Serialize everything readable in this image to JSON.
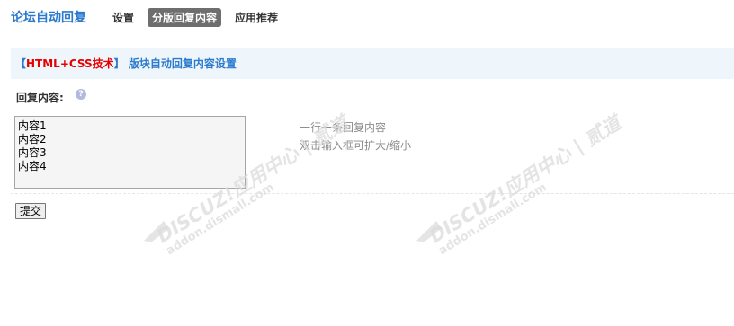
{
  "header": {
    "app_title": "论坛自动回复",
    "tabs": [
      {
        "label": "设置",
        "active": false
      },
      {
        "label": "分版回复内容",
        "active": true
      },
      {
        "label": "应用推荐",
        "active": false
      }
    ]
  },
  "section": {
    "bracket_open": "【",
    "highlight": "HTML+CSS技术",
    "bracket_close": "】",
    "title": " 版块自动回复内容设置"
  },
  "form": {
    "label": "回复内容:",
    "help_icon": "question-bubble-icon",
    "textarea_value": "内容1\n内容2\n内容3\n内容4",
    "tip_line1": "一行一条回复内容",
    "tip_line2": "双击输入框可扩大/缩小",
    "submit_label": "提交"
  },
  "watermark": {
    "line1": "DISCUZ!应用中心 | 贰道",
    "line2": "addon.dismall.com"
  },
  "colors": {
    "accent": "#2b7acd",
    "highlight": "#e60000",
    "section_bg": "#eef6fb",
    "active_tab_bg": "#6e6e6e",
    "tip_text": "#8c8c8c"
  }
}
